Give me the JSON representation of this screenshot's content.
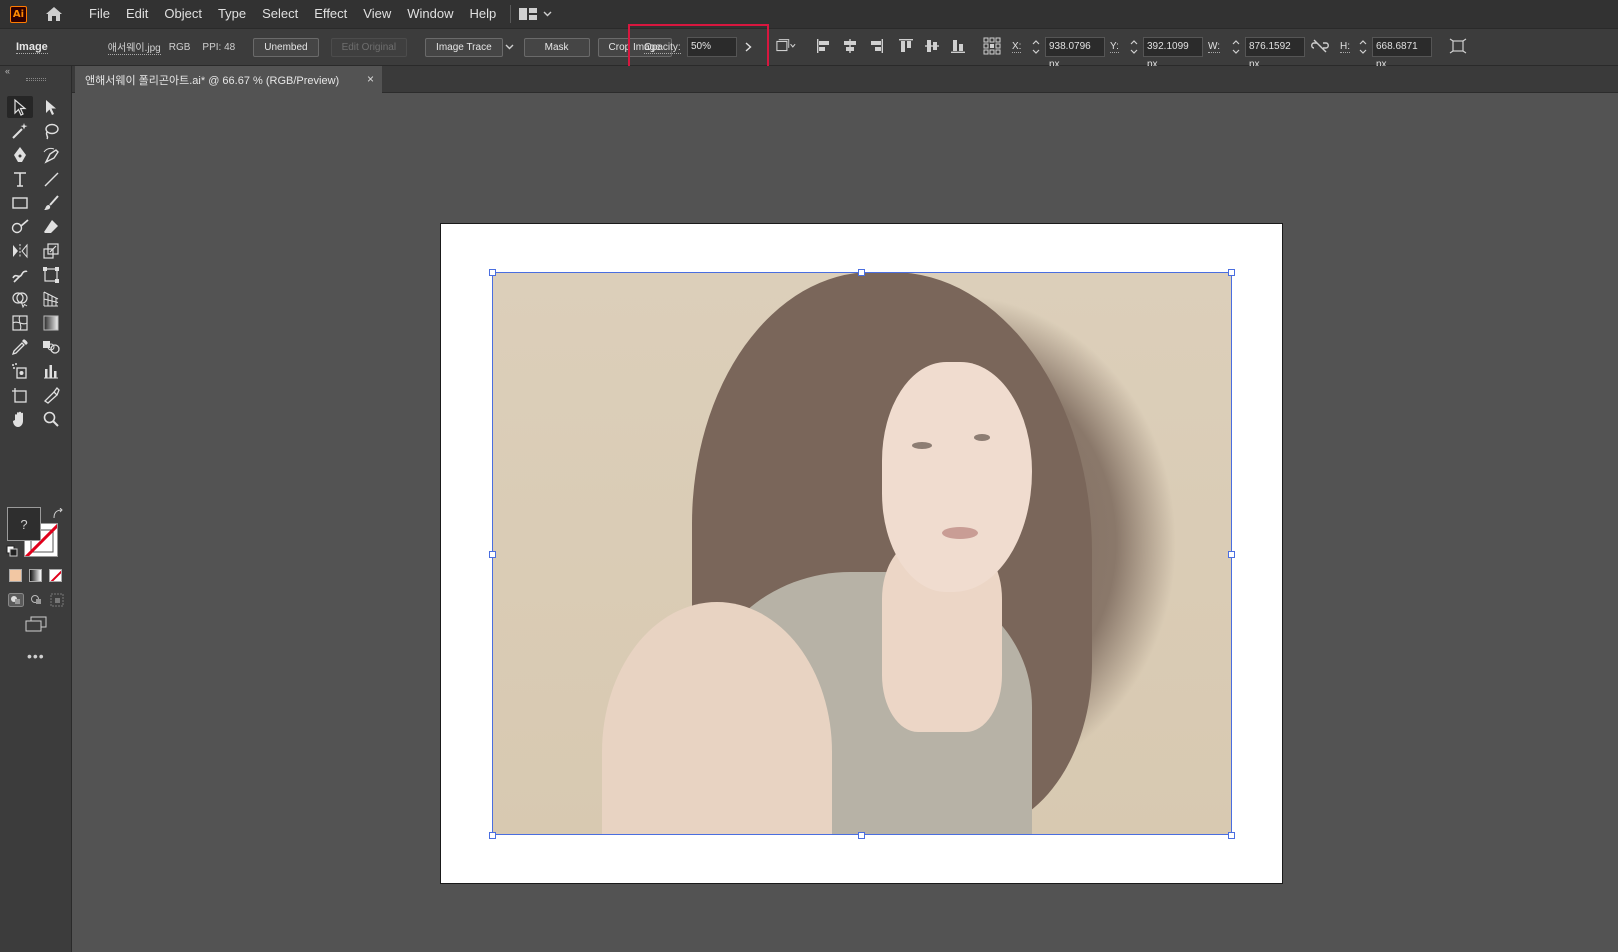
{
  "menubar": {
    "logo": "Ai",
    "items": [
      "File",
      "Edit",
      "Object",
      "Type",
      "Select",
      "Effect",
      "View",
      "Window",
      "Help"
    ]
  },
  "controlbar": {
    "object_type": "Image",
    "filename": "애서웨이.jpg",
    "color_mode": "RGB",
    "ppi": "PPI: 48",
    "unembed": "Unembed",
    "edit_original": "Edit Original",
    "image_trace": "Image Trace",
    "mask": "Mask",
    "crop_image": "Crop Image",
    "opacity_label": "Opacity:",
    "opacity_value": "50%",
    "x_label": "X:",
    "x_value": "938.0796 px",
    "y_label": "Y:",
    "y_value": "392.1099 px",
    "w_label": "W:",
    "w_value": "876.1592 px",
    "h_label": "H:",
    "h_value": "668.6871 px"
  },
  "document_tab": {
    "title": "앤해서웨이 폴리곤아트.ai* @ 66.67 % (RGB/Preview)",
    "close": "×"
  },
  "tools": {
    "fill_none_label": "?",
    "more": "•••"
  },
  "colors": {
    "highlight": "#d8173f",
    "selection": "#4a6ee0",
    "chrome_dark": "#323232",
    "chrome_mid": "#3c3c3c",
    "pasteboard": "#535353"
  }
}
